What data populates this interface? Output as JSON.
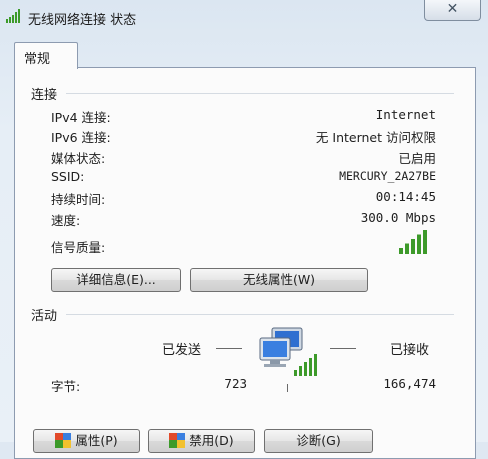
{
  "window": {
    "title": "无线网络连接 状态",
    "close_glyph": "✕"
  },
  "tabs": [
    {
      "label": "常规"
    }
  ],
  "connection": {
    "section_title": "连接",
    "rows": [
      {
        "label": "IPv4 连接:",
        "value": "Internet"
      },
      {
        "label": "IPv6 连接:",
        "value": "无 Internet 访问权限"
      },
      {
        "label": "媒体状态:",
        "value": "已启用"
      },
      {
        "label": "SSID:",
        "value": "MERCURY_2A27BE"
      },
      {
        "label": "持续时间:",
        "value": "00:14:45"
      },
      {
        "label": "速度:",
        "value": "300.0 Mbps"
      }
    ],
    "signal_label": "信号质量:",
    "signal_level": 5,
    "signal_max": 5,
    "details_button": "详细信息(E)...",
    "wireless_props_button": "无线属性(W)"
  },
  "activity": {
    "section_title": "活动",
    "sent_label": "已发送",
    "received_label": "已接收",
    "bytes_label": "字节:",
    "bytes_sent": "723",
    "bytes_received": "166,474"
  },
  "bottom_buttons": {
    "properties": "属性(P)",
    "disable": "禁用(D)",
    "diagnose": "诊断(G)"
  },
  "colors": {
    "signal_green": "#3d9a2a",
    "monitor_blue": "#2f6fd0",
    "window_bg": "#e9f0f7"
  }
}
